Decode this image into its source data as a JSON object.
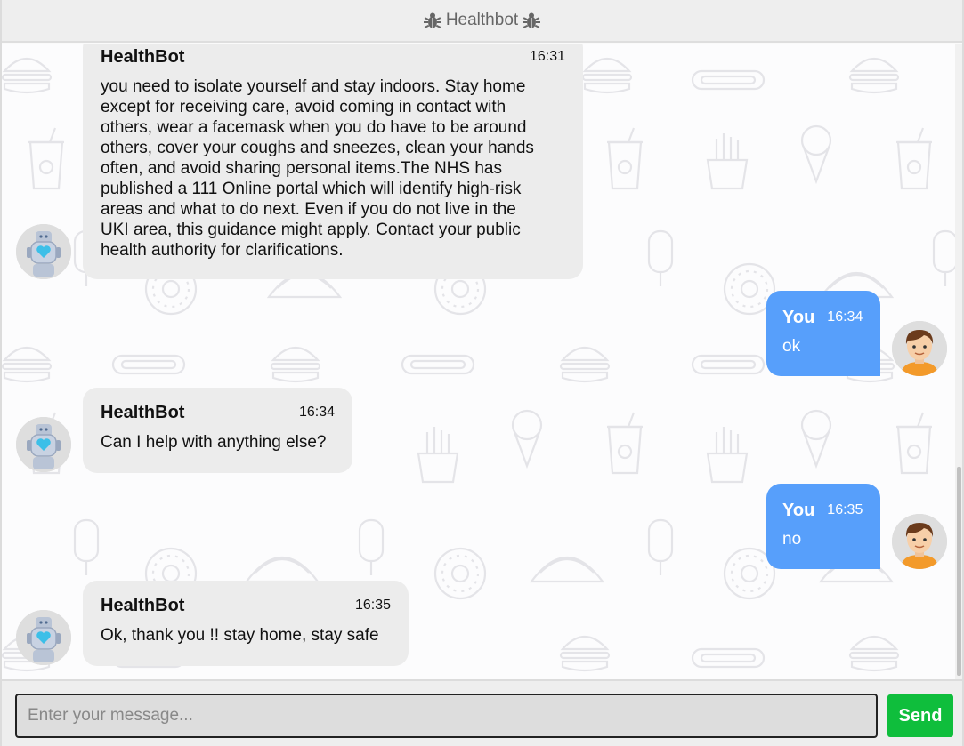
{
  "header": {
    "title": "Healthbot",
    "icon_left": "bug-icon",
    "icon_right": "bug-icon"
  },
  "colors": {
    "user_bubble": "#579ffb",
    "bot_bubble": "#ececec",
    "send_button": "#0fbe3c"
  },
  "messages": [
    {
      "sender": "HealthBot",
      "time": "16:31",
      "lines": [
        "you need to isolate yourself and stay indoors. Stay home",
        "except for receiving care, avoid coming in contact with",
        "others, wear a facemask when you do have to be around",
        "others, cover your coughs and sneezes, clean your hands",
        "often, and avoid sharing personal items.The NHS has",
        "published a 111 Online portal which will identify high-risk",
        "areas and what to do next. Even if you do not live in the",
        "UKI area, this guidance might apply. Contact your public",
        "health authority for clarifications."
      ]
    },
    {
      "sender": "You",
      "time": "16:34",
      "text": "ok"
    },
    {
      "sender": "HealthBot",
      "time": "16:34",
      "text": "Can I help with anything else?"
    },
    {
      "sender": "You",
      "time": "16:35",
      "text": "no"
    },
    {
      "sender": "HealthBot",
      "time": "16:35",
      "text": "Ok, thank you !! stay home, stay safe"
    }
  ],
  "composer": {
    "placeholder": "Enter your message...",
    "value": "",
    "send_label": "Send"
  }
}
